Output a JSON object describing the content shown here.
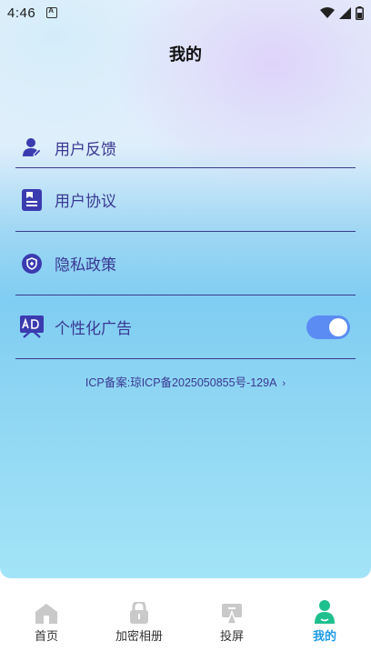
{
  "status_bar": {
    "time": "4:46"
  },
  "page_title": "我的",
  "menu": {
    "items": [
      {
        "label": "用户反馈",
        "icon": "user-feedback-icon"
      },
      {
        "label": "用户协议",
        "icon": "document-icon"
      },
      {
        "label": "隐私政策",
        "icon": "shield-icon"
      },
      {
        "label": "个性化广告",
        "icon": "ad-icon",
        "toggle_on": true
      }
    ]
  },
  "icp": {
    "text": "ICP备案:琼ICP备2025050855号-129A"
  },
  "tab_bar": {
    "tabs": [
      {
        "label": "首页",
        "icon": "home-icon",
        "active": false
      },
      {
        "label": "加密相册",
        "icon": "lock-icon",
        "active": false
      },
      {
        "label": "投屏",
        "icon": "cast-icon",
        "active": false
      },
      {
        "label": "我的",
        "icon": "profile-icon",
        "active": true
      }
    ]
  },
  "colors": {
    "accent_text": "#3a3892",
    "toggle_on": "#5b8cf3",
    "active_tab": "#1e9ce6",
    "active_tab_icon": "#1fc08e",
    "inactive_tab_icon": "#c9c9c9"
  }
}
